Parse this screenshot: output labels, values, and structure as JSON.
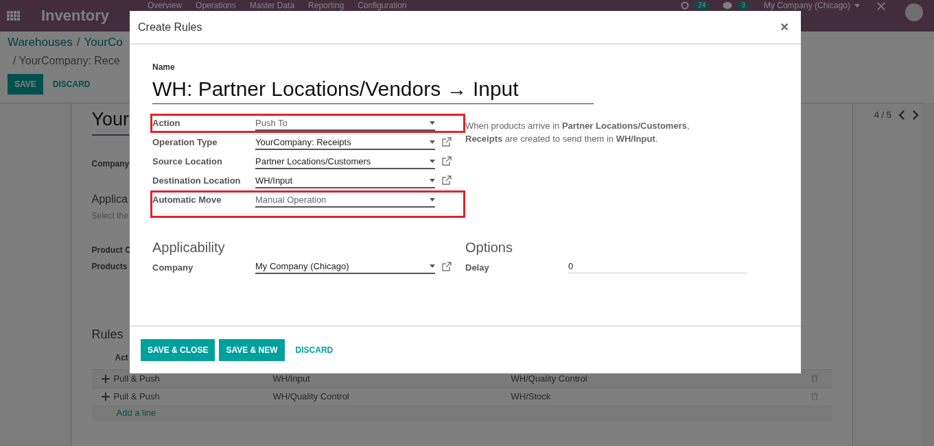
{
  "navbar": {
    "app_name": "Inventory",
    "menu": [
      "Overview",
      "Operations",
      "Master Data",
      "Reporting",
      "Configuration"
    ],
    "activity_count": "24",
    "message_count": "3",
    "company": "My Company (Chicago)"
  },
  "breadcrumb": {
    "items": [
      "Warehouses",
      "YourCo"
    ],
    "separator": "/",
    "current": "/ YourCompany: Rece"
  },
  "actions": {
    "save": "SAVE",
    "discard": "DISCARD"
  },
  "pager": "4 / 5",
  "sheet": {
    "title": "Your",
    "company_label": "Company",
    "section_title": "Applica",
    "section_hint": "Select the",
    "fields": [
      "Product C",
      "Products"
    ],
    "rules_title": "Rules",
    "rules_header": "Act",
    "rules": [
      {
        "action": "Pull & Push",
        "source": "WH/Input",
        "destination": "WH/Quality Control"
      },
      {
        "action": "Pull & Push",
        "source": "WH/Quality Control",
        "destination": "WH/Stock"
      }
    ],
    "add_line": "Add a line"
  },
  "dialog": {
    "title": "Create Rules",
    "close": "×",
    "name_label": "Name",
    "name": "WH: Partner Locations/Vendors → Input",
    "fields": [
      {
        "label": "Action",
        "value": "Push To",
        "kind": "select",
        "highlighted": true
      },
      {
        "label": "Operation Type",
        "value": "YourCompany: Receipts",
        "kind": "relation",
        "highlighted": false
      },
      {
        "label": "Source Location",
        "value": "Partner Locations/Customers",
        "kind": "relation",
        "highlighted": false
      },
      {
        "label": "Destination Location",
        "value": "WH/Input",
        "kind": "relation",
        "highlighted": false
      },
      {
        "label": "Automatic Move",
        "value": "Manual Operation",
        "kind": "select",
        "highlighted": true
      }
    ],
    "help": "When products arrive in **Partner Locations/Customers**, **Receipts** are created to send them in **WH/Input**.",
    "applicability": {
      "title": "Applicability",
      "fields": [
        {
          "label": "Company",
          "value": "My Company (Chicago)",
          "kind": "relation",
          "highlighted": false
        }
      ]
    },
    "options": {
      "title": "Options",
      "fields": [
        {
          "label": "Delay",
          "value": "0"
        }
      ]
    },
    "buttons": [
      {
        "label": "SAVE & CLOSE",
        "kind": "primary"
      },
      {
        "label": "SAVE & NEW",
        "kind": "primary"
      },
      {
        "label": "DISCARD",
        "kind": "link"
      }
    ]
  }
}
